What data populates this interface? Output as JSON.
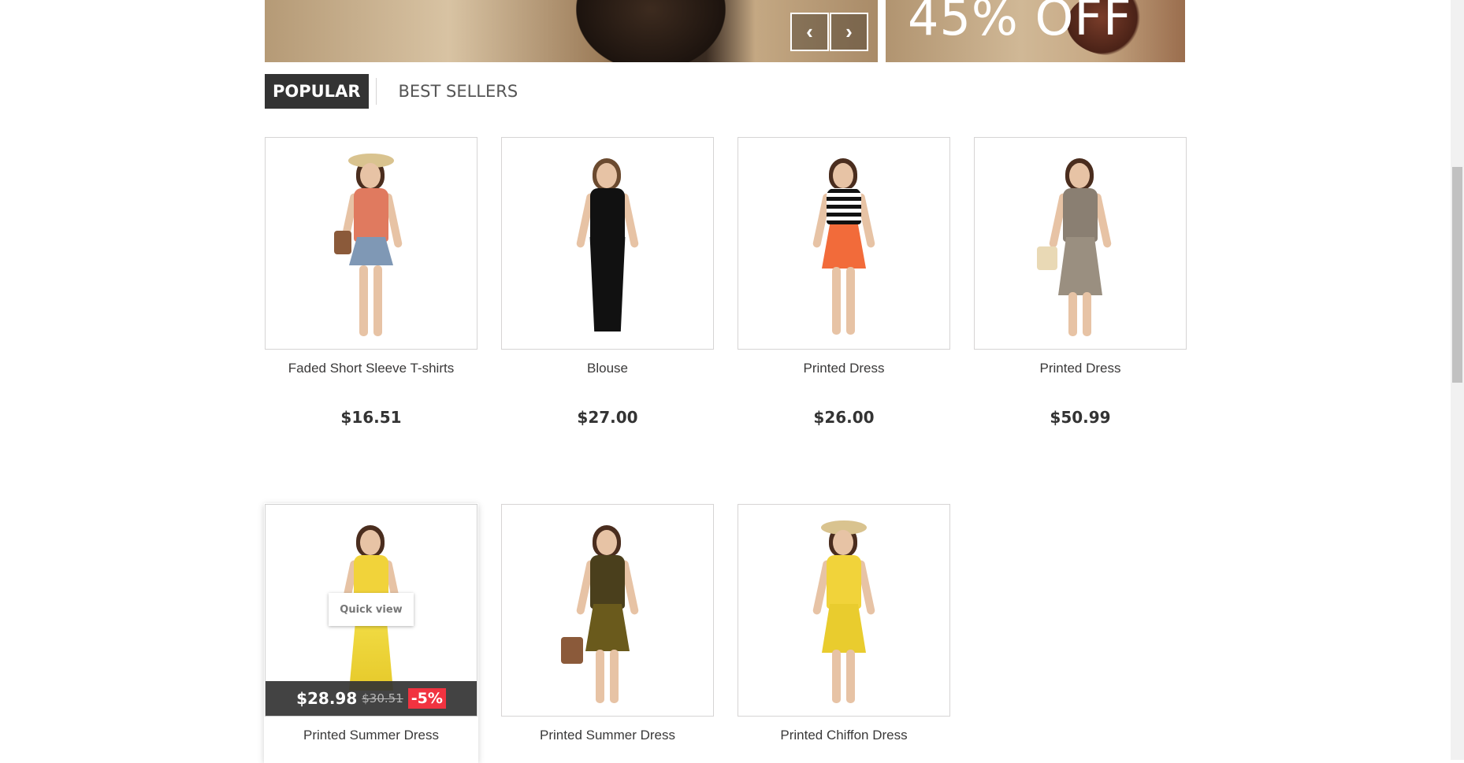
{
  "banner": {
    "promo_text": "45% OFF",
    "prev_icon": "chevron-left-icon",
    "next_icon": "chevron-right-icon"
  },
  "tabs": [
    {
      "label": "POPULAR",
      "active": true
    },
    {
      "label": "BEST SELLERS",
      "active": false
    }
  ],
  "products": [
    {
      "name": "Faded Short Sleeve T-shirts",
      "price": "$16.51"
    },
    {
      "name": "Blouse",
      "price": "$27.00"
    },
    {
      "name": "Printed Dress",
      "price": "$26.00"
    },
    {
      "name": "Printed Dress",
      "price": "$50.99"
    },
    {
      "name": "Printed Summer Dress",
      "price_new": "$28.98",
      "price_old": "$30.51",
      "discount": "-5%",
      "quick_view": "Quick view"
    },
    {
      "name": "Printed Summer Dress"
    },
    {
      "name": "Printed Chiffon Dress"
    }
  ],
  "colors": {
    "tab_active_bg": "#333333",
    "discount_badge": "#f13340",
    "border": "#d6d4d4"
  }
}
